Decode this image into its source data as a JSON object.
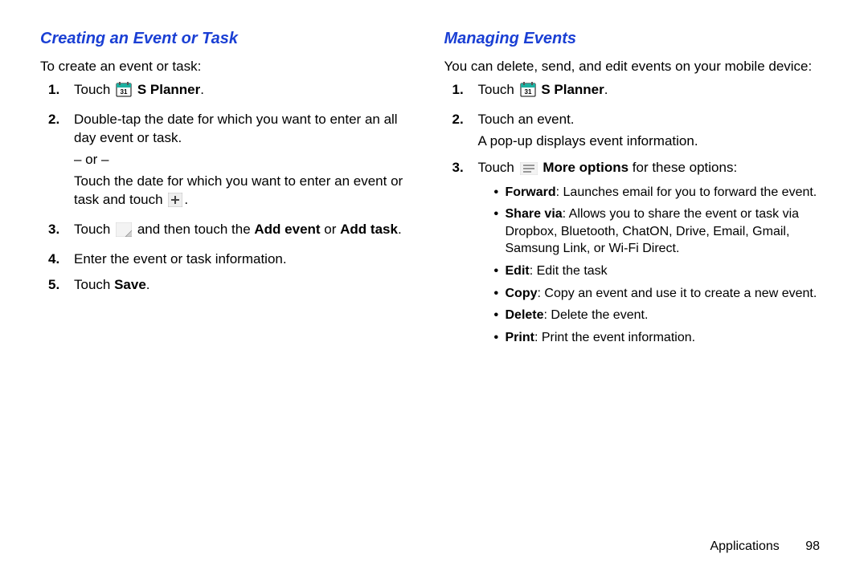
{
  "left": {
    "heading": "Creating an Event or Task",
    "lead": "To create an event or task:",
    "steps": {
      "s1_num": "1.",
      "s1_a": "Touch ",
      "s1_b": " S Planner",
      "s1_c": ".",
      "s2_num": "2.",
      "s2_a": "Double-tap the date for which you want to enter an all day event or task.",
      "s2_or": "– or –",
      "s2_b1": "Touch the date for which you want to enter an event or task and touch ",
      "s2_b2": ".",
      "s3_num": "3.",
      "s3_a": "Touch ",
      "s3_b": " and then touch the ",
      "s3_c": "Add event",
      "s3_d": " or ",
      "s3_e": "Add task",
      "s3_f": ".",
      "s4_num": "4.",
      "s4_a": "Enter the event or task information.",
      "s5_num": "5.",
      "s5_a": "Touch ",
      "s5_b": "Save",
      "s5_c": "."
    },
    "calendar_day": "31"
  },
  "right": {
    "heading": "Managing Events",
    "lead": "You can delete, send, and edit events on your mobile device:",
    "steps": {
      "s1_num": "1.",
      "s1_a": "Touch ",
      "s1_b": " S Planner",
      "s1_c": ".",
      "s2_num": "2.",
      "s2_a": "Touch an event.",
      "s2_b": "A pop-up displays event information.",
      "s3_num": "3.",
      "s3_a": "Touch ",
      "s3_b": " More options",
      "s3_c": " for these options:"
    },
    "opts": {
      "forward_b": "Forward",
      "forward_t": ": Launches email for you to forward the event.",
      "share_b": "Share via",
      "share_t": ": Allows you to share the event or task via Dropbox, Bluetooth, ChatON, Drive, Email, Gmail, Samsung Link, or Wi-Fi Direct.",
      "edit_b": "Edit",
      "edit_t": ": Edit the task",
      "copy_b": "Copy",
      "copy_t": ": Copy an event and use it to create a new event.",
      "delete_b": "Delete",
      "delete_t": ": Delete the event.",
      "print_b": "Print",
      "print_t": ": Print the event information."
    },
    "calendar_day": "31"
  },
  "footer": {
    "section": "Applications",
    "page": "98"
  }
}
